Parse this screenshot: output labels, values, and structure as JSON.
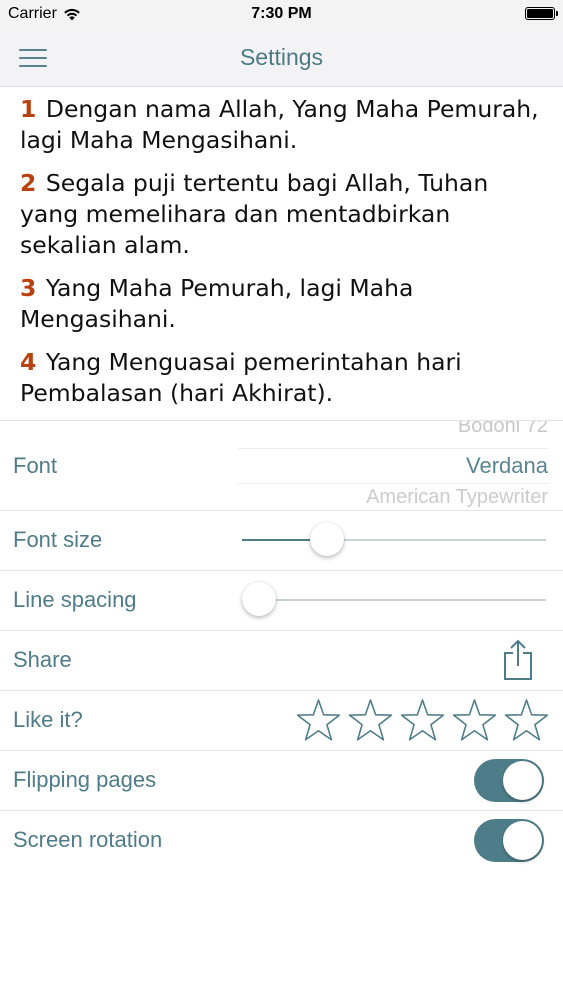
{
  "status_bar": {
    "carrier": "Carrier",
    "time": "7:30 PM"
  },
  "nav": {
    "title": "Settings"
  },
  "verses": [
    {
      "number": "1",
      "text": "Dengan nama Allah, Yang Maha Pemurah, lagi Maha Mengasihani."
    },
    {
      "number": "2",
      "text": "Segala puji tertentu bagi Allah, Tuhan yang memelihara dan mentadbirkan sekalian alam."
    },
    {
      "number": "3",
      "text": "Yang Maha Pemurah, lagi Maha Mengasihani."
    },
    {
      "number": "4",
      "text": "Yang Menguasai pemerintahan hari Pembalasan (hari Akhirat)."
    }
  ],
  "settings": {
    "font": {
      "label": "Font",
      "options_visible": [
        "Bodoni 72",
        "Verdana",
        "American Typewriter"
      ],
      "selected": "Verdana"
    },
    "font_size": {
      "label": "Font size",
      "value_fraction": 0.25
    },
    "line_spacing": {
      "label": "Line spacing",
      "value_fraction": 0.0
    },
    "share": {
      "label": "Share"
    },
    "rating": {
      "label": "Like it?",
      "stars_total": 5,
      "stars_filled": 0
    },
    "flipping_pages": {
      "label": "Flipping pages",
      "on": true
    },
    "screen_rotation": {
      "label": "Screen rotation",
      "on": true
    }
  },
  "colors": {
    "accent": "#4e7d8a",
    "verse_number": "#b8420f"
  }
}
